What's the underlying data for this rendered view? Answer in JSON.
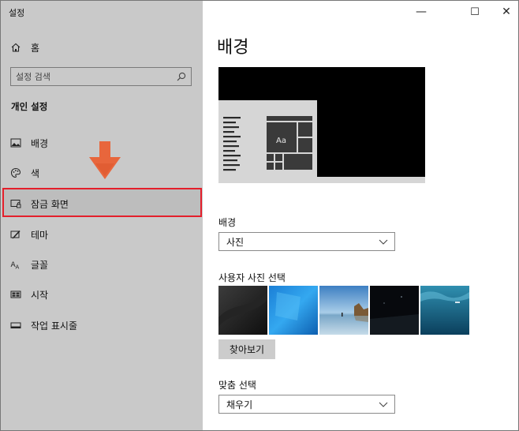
{
  "window": {
    "title": "설정",
    "controls": {
      "minimize": "—",
      "maximize": "☐",
      "close": "✕"
    }
  },
  "sidebar": {
    "home_label": "홈",
    "search_placeholder": "설정 검색",
    "section_title": "개인 설정",
    "items": [
      {
        "label": "배경",
        "icon": "image-icon"
      },
      {
        "label": "색",
        "icon": "palette-icon"
      },
      {
        "label": "잠금 화면",
        "icon": "lock-screen-icon",
        "selected": true
      },
      {
        "label": "테마",
        "icon": "theme-brush-icon"
      },
      {
        "label": "글꼴",
        "icon": "font-icon"
      },
      {
        "label": "시작",
        "icon": "start-tiles-icon"
      },
      {
        "label": "작업 표시줄",
        "icon": "taskbar-icon"
      }
    ]
  },
  "main": {
    "page_title": "배경",
    "preview": {
      "tile_text": "Aa"
    },
    "background_label": "배경",
    "background_value": "사진",
    "choose_picture_label": "사용자 사진 선택",
    "browse_label": "찾아보기",
    "fit_label": "맞춤 선택",
    "fit_value": "채우기"
  },
  "annotation": {
    "highlight_color": "#e41f2b",
    "arrow_color": "#e8663c"
  },
  "colors": {
    "sidebar_bg": "#c9c9c9",
    "content_bg": "#ffffff"
  }
}
